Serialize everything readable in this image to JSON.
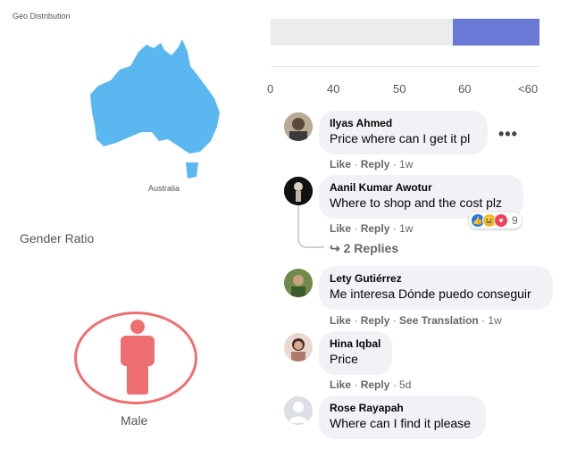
{
  "geo": {
    "title": "Geo Distribution",
    "region_label": "Australia",
    "map_color": "#5bb7f0"
  },
  "gender": {
    "title": "Gender Ratio",
    "label": "Male",
    "color": "#ef6f70"
  },
  "age_bar": {
    "ticks": [
      "0",
      "40",
      "50",
      "60",
      "<60"
    ],
    "fill_color": "#6a78d6"
  },
  "comments": [
    {
      "name": "Ilyas Ahmed",
      "text": "Price where can I get it pl",
      "like": "Like",
      "reply": "Reply",
      "time": "1w"
    },
    {
      "name": "Aanil Kumar Awotur",
      "text": "Where to shop and the cost plz",
      "like": "Like",
      "reply": "Reply",
      "time": "1w",
      "reactions_count": "9",
      "replies_label": "2 Replies"
    },
    {
      "name": "Lety Gutiérrez",
      "text": "Me interesa Dónde puedo conseguir",
      "like": "Like",
      "reply": "Reply",
      "translation": "See Translation",
      "time": "1w"
    },
    {
      "name": "Hina Iqbal",
      "text": "Price",
      "like": "Like",
      "reply": "Reply",
      "time": "5d"
    },
    {
      "name": "Rose Rayapah",
      "text": "Where can I find it please"
    }
  ],
  "more_options": "•••"
}
